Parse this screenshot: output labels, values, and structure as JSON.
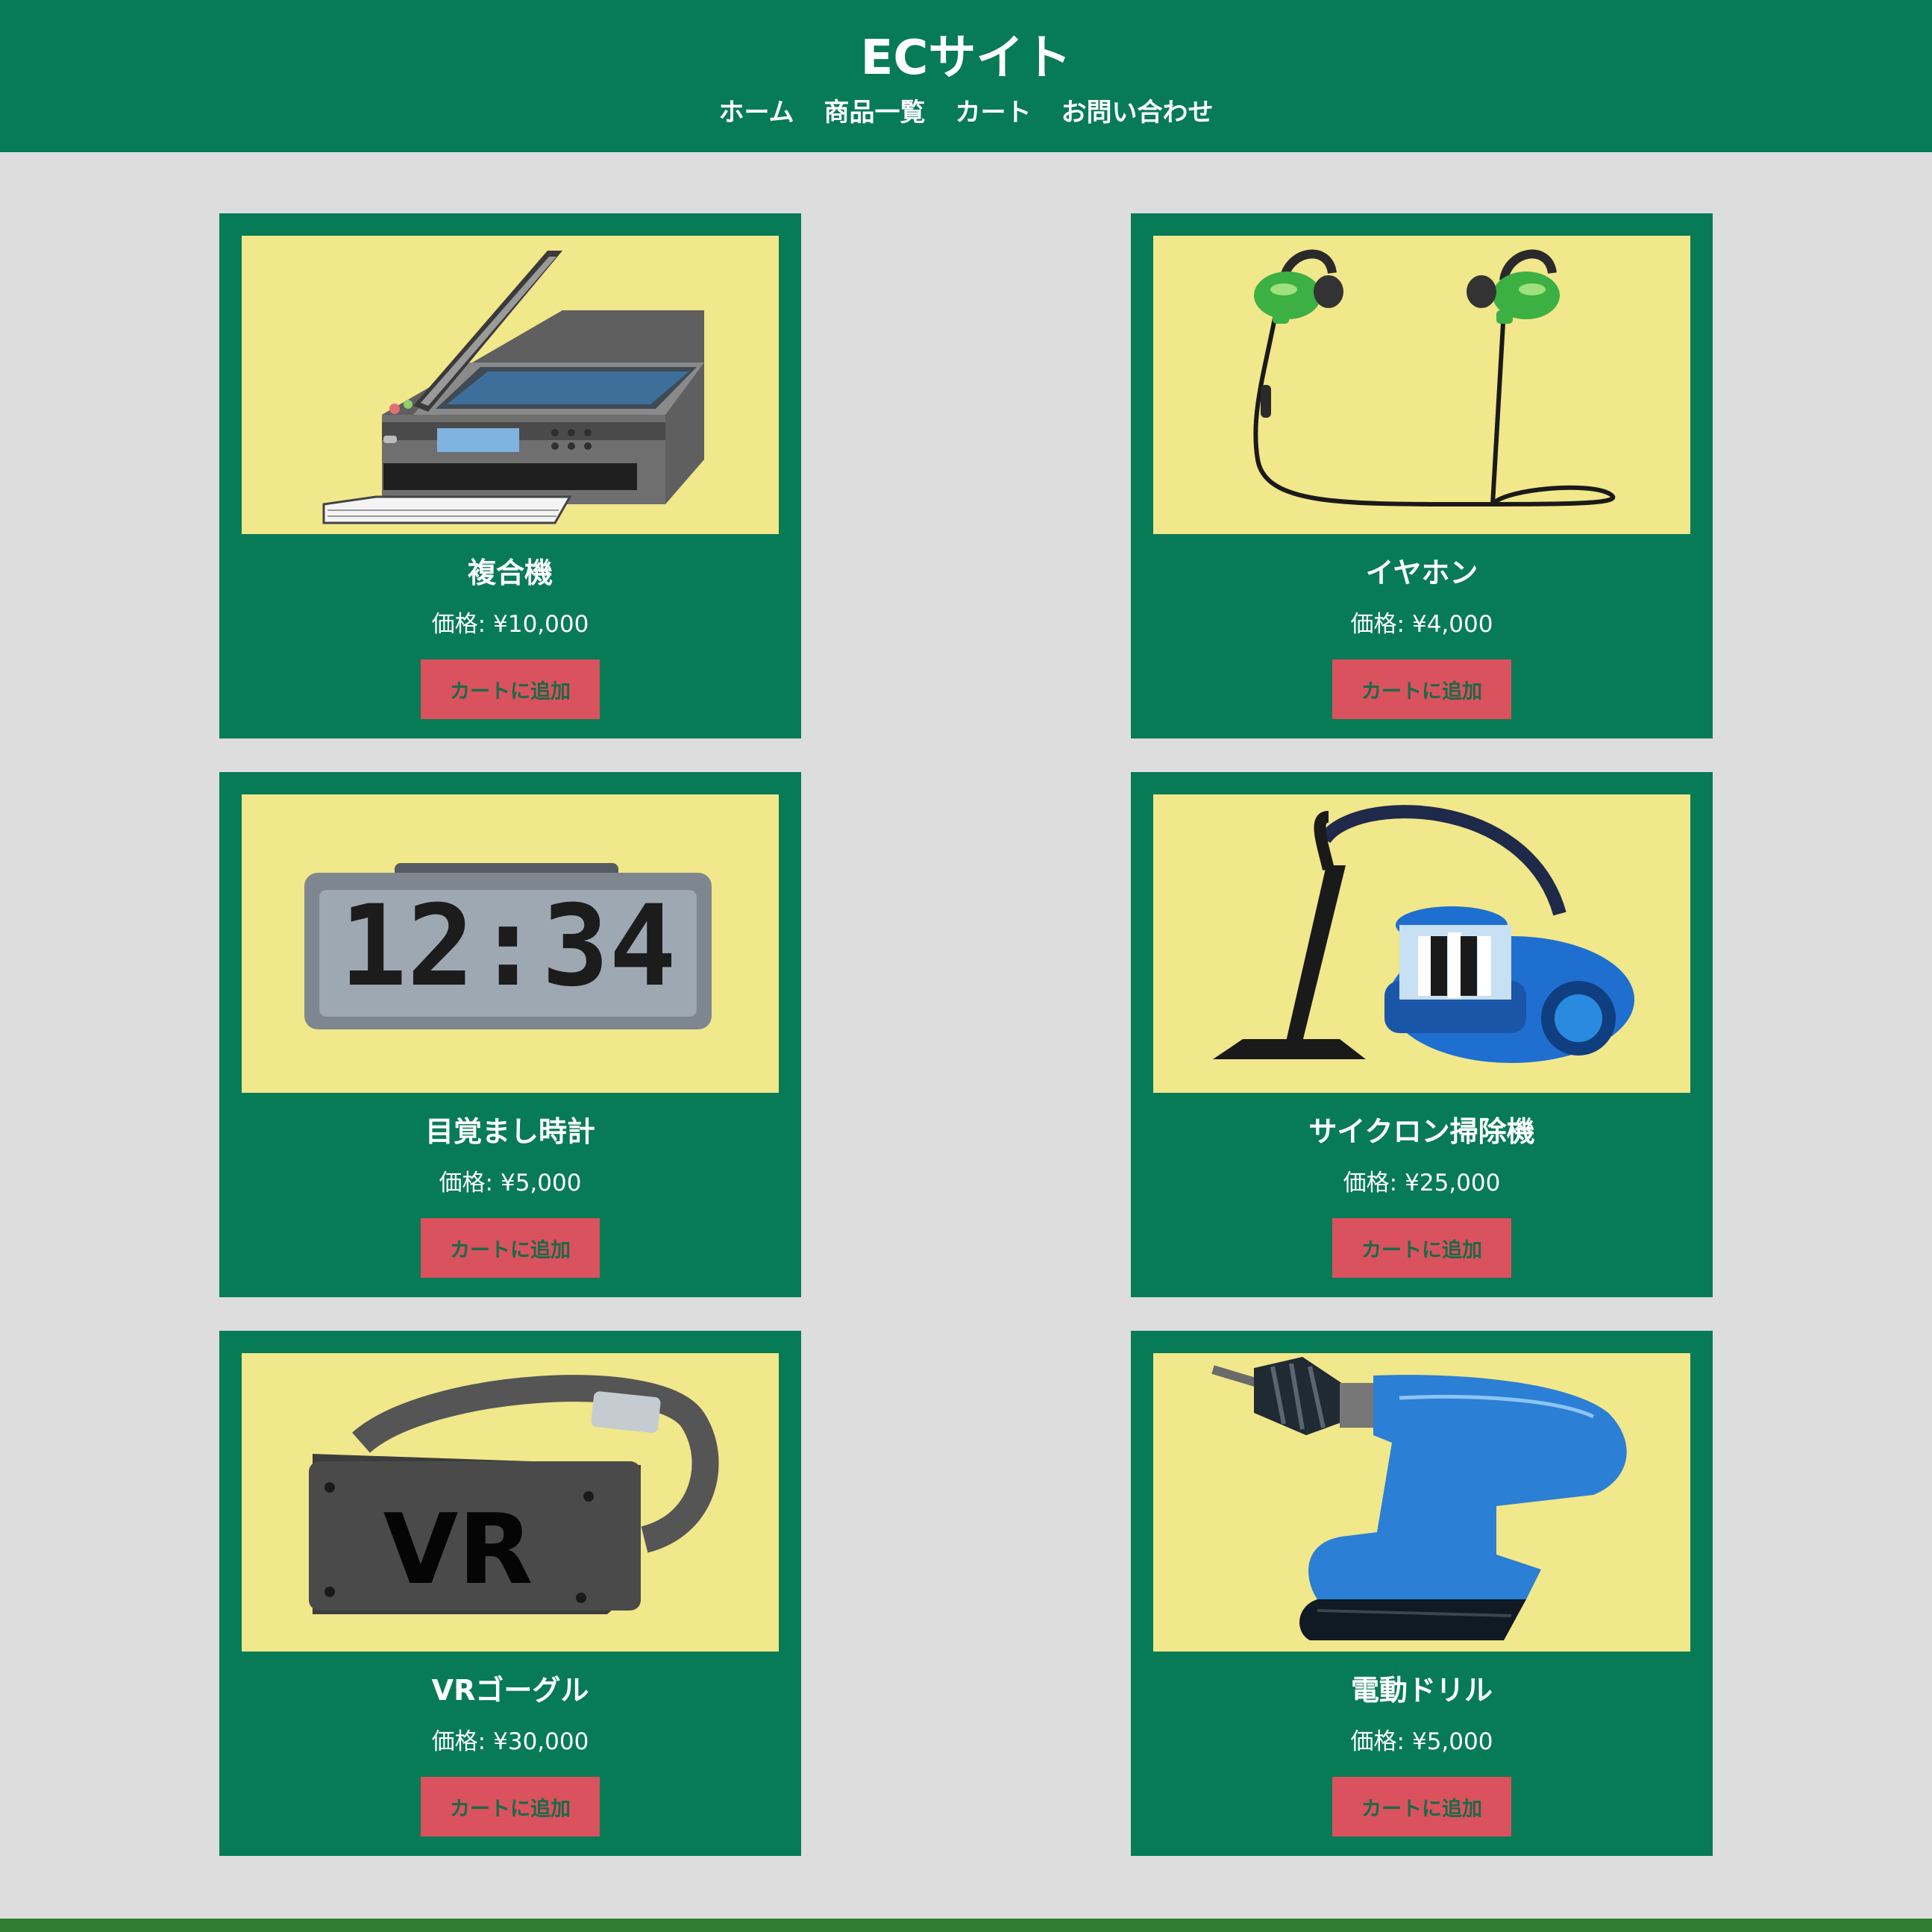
{
  "header": {
    "title": "ECサイト",
    "nav": [
      "ホーム",
      "商品一覧",
      "カート",
      "お問い合わせ"
    ]
  },
  "currency_symbol": "¥",
  "price_label": "価格:",
  "add_to_cart_label": "カートに追加",
  "products": [
    {
      "name": "複合機",
      "price": "¥10,000",
      "image": "printer-icon"
    },
    {
      "name": "イヤホン",
      "price": "¥4,000",
      "image": "earphones-icon"
    },
    {
      "name": "目覚まし時計",
      "price": "¥5,000",
      "image": "alarm-clock-icon",
      "clock_display": "12:34"
    },
    {
      "name": "サイクロン掃除機",
      "price": "¥25,000",
      "image": "vacuum-cleaner-icon"
    },
    {
      "name": "VRゴーグル",
      "price": "¥30,000",
      "image": "vr-goggles-icon",
      "goggles_label": "VR"
    },
    {
      "name": "電動ドリル",
      "price": "¥5,000",
      "image": "electric-drill-icon"
    }
  ],
  "colors": {
    "header_bg": "#077b56",
    "page_bg": "#dddddd",
    "card_bg": "#077b56",
    "image_bg": "#f1e78b",
    "button_bg": "#d9525e",
    "button_text": "#1b6a48",
    "footer": "#2e7d32"
  }
}
